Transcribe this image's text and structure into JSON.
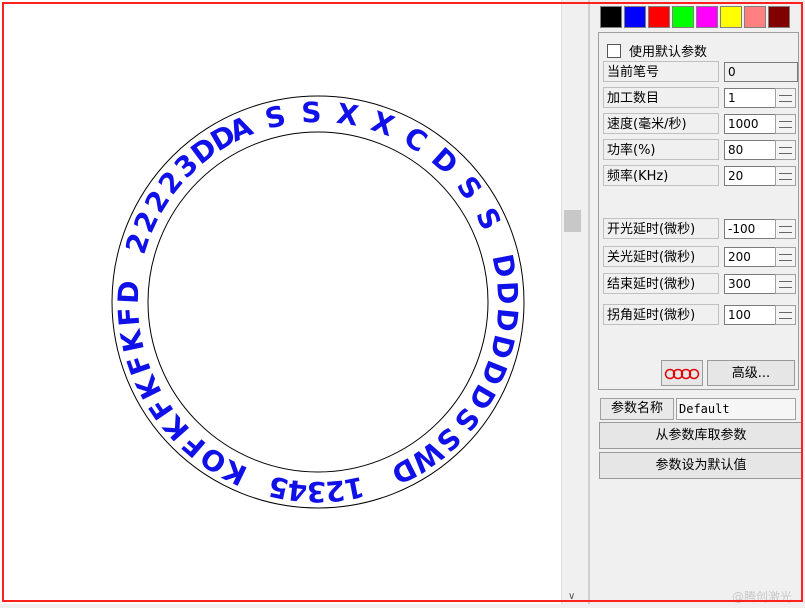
{
  "canvas": {
    "rings": [
      {
        "r": 206
      },
      {
        "r": 170
      }
    ],
    "text_color": "#1010e8",
    "arc_texts": [
      {
        "text": "ASSXXCDSS",
        "startDeg": -24,
        "endDeg": 64
      },
      {
        "text": "DDDDDDSSWD",
        "startDeg": 79,
        "endDeg": 153
      },
      {
        "text": "12345",
        "startDeg": 169,
        "endDeg": 192
      },
      {
        "text": "KOFKFKFKFD",
        "startDeg": 206,
        "endDeg": 273
      },
      {
        "text": "22223DD",
        "startDeg": -72,
        "endDeg": -30
      }
    ]
  },
  "palette": [
    "#000000",
    "#0000ff",
    "#ff0000",
    "#00ff00",
    "#ff00ff",
    "#ffff00",
    "#ff8080",
    "#800000"
  ],
  "params": {
    "use_default_label": "使用默认参数",
    "rows": [
      {
        "label": "当前笔号",
        "value": "0"
      },
      {
        "label": "加工数目",
        "value": "1"
      },
      {
        "label": "速度(毫米/秒)",
        "value": "1000"
      },
      {
        "label": "功率(%)",
        "value": "80"
      },
      {
        "label": "频率(KHz)",
        "value": "20"
      },
      {
        "label": "开光延时(微秒)",
        "value": "-100"
      },
      {
        "label": "关光延时(微秒)",
        "value": "200"
      },
      {
        "label": "结束延时(微秒)",
        "value": "300"
      },
      {
        "label": "拐角延时(微秒)",
        "value": "100"
      }
    ],
    "advanced_label": "高级..."
  },
  "param_name": {
    "label": "参数名称",
    "value": "Default"
  },
  "buttons": {
    "load_from_library": "从参数库取参数",
    "set_default": "参数设为默认值"
  },
  "watermark": "@腾创激光"
}
